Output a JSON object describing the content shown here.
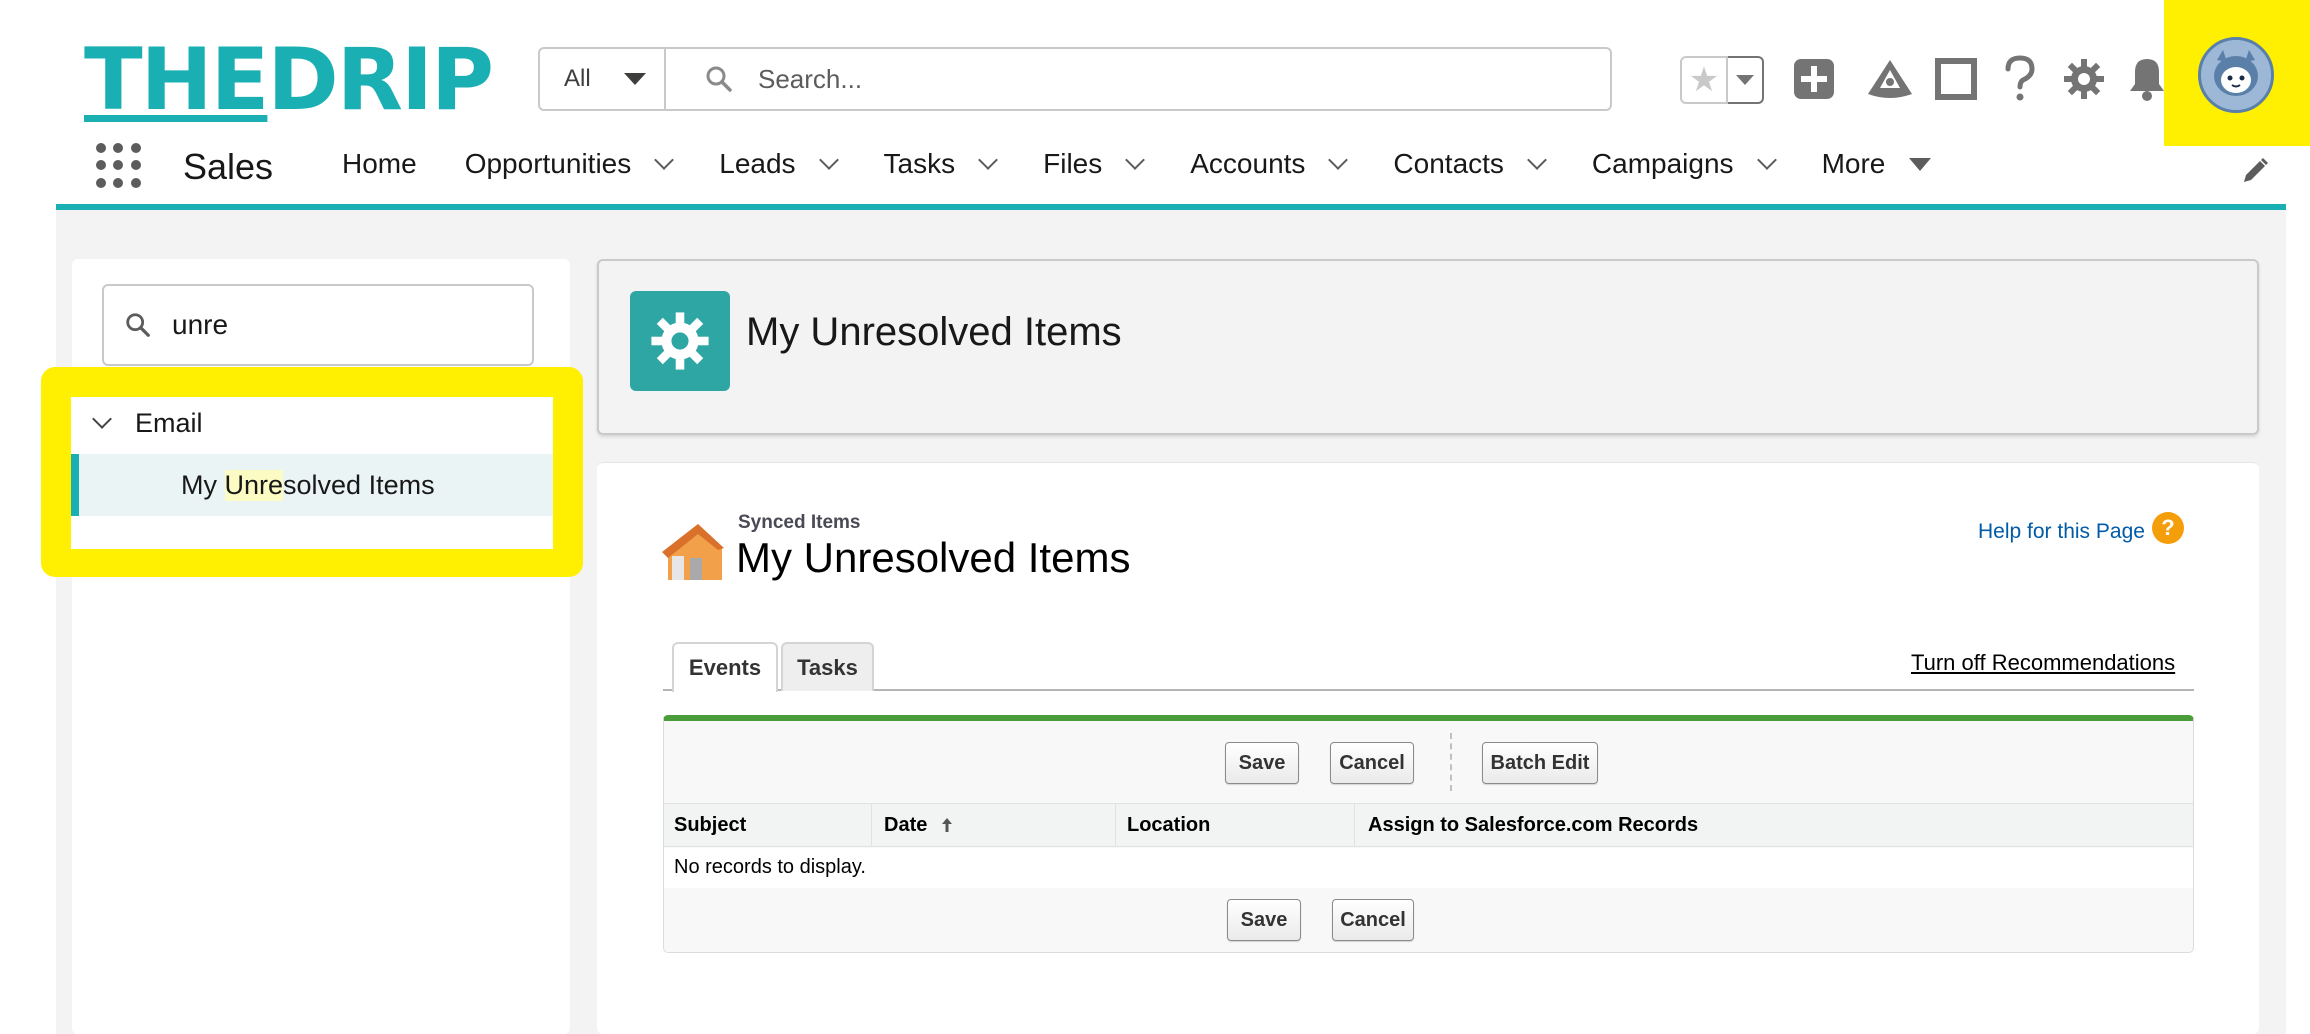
{
  "header": {
    "logo_the": "THE",
    "logo_drip": "DRIP",
    "search_scope": "All",
    "search_placeholder": "Search..."
  },
  "nav": {
    "app_name": "Sales",
    "items": [
      {
        "label": "Home"
      },
      {
        "label": "Opportunities"
      },
      {
        "label": "Leads"
      },
      {
        "label": "Tasks"
      },
      {
        "label": "Files"
      },
      {
        "label": "Accounts"
      },
      {
        "label": "Contacts"
      },
      {
        "label": "Campaigns"
      },
      {
        "label": "More"
      }
    ]
  },
  "setup_tree": {
    "quick_find_value": "unre",
    "parent_label": "Email",
    "child_prefix": "My ",
    "child_match": "Unre",
    "child_suffix": "solved Items"
  },
  "page_header": {
    "title": "My Unresolved Items"
  },
  "content": {
    "subtitle": "Synced Items",
    "title": "My Unresolved Items",
    "help_link": "Help for this Page",
    "help_icon_glyph": "?",
    "tabs": [
      {
        "label": "Events",
        "active": true
      },
      {
        "label": "Tasks",
        "active": false
      }
    ],
    "turn_off_link": "Turn off Recommendations",
    "buttons": {
      "save": "Save",
      "cancel": "Cancel",
      "batch_edit": "Batch Edit"
    },
    "columns": [
      {
        "label": "Subject"
      },
      {
        "label": "Date"
      },
      {
        "label": "Location"
      },
      {
        "label": "Assign to Salesforce.com Records"
      }
    ],
    "empty_message": "No records to display."
  },
  "colors": {
    "brand_teal": "#1ab0b3",
    "highlight_yellow": "#ffef00",
    "list_accent_green": "#4b9c3a",
    "link_blue": "#015ba7"
  },
  "icons": [
    "search-icon",
    "star-icon",
    "add-icon",
    "trailhead-icon",
    "square-icon",
    "help-icon",
    "gear-icon",
    "bell-icon",
    "app-launcher-icon",
    "pencil-icon",
    "house-icon",
    "sort-arrow-icon"
  ]
}
